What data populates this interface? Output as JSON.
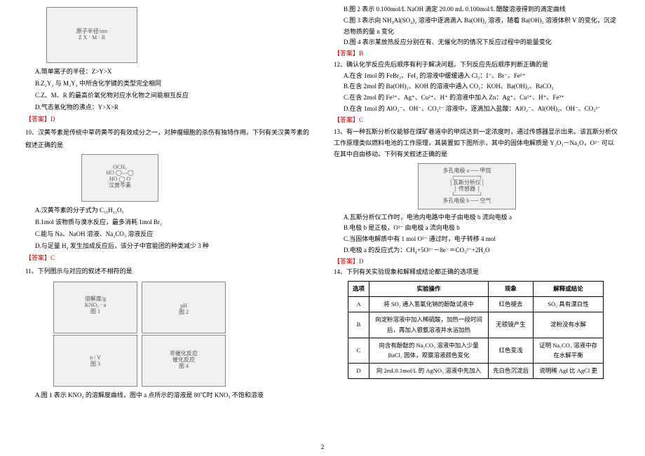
{
  "pageNumber": "2",
  "left": {
    "opt9A": "A.简单离子的半径：Z>Y>X",
    "opt9B": "B.Z₂Y₂ 与 M₂Y₂ 中所含化学键的类型完全相同",
    "opt9C": "C.Z、M、R 的最高价氧化物对应水化物之间能相互反应",
    "opt9D": "D.气态氢化物的沸点：Y>X>R",
    "ans9": "【答案】D",
    "q10": "10、汉黄芩素是传统中草药黄芩的有效成分之一，对肿瘤细胞的杀伤有独特作用。下列有关汉黄芩素的叙述正确的是",
    "fig10Caption": "汉黄芩素",
    "opt10A": "A.汉黄芩素的分子式为 C₁₆H₁₂O₅",
    "opt10B": "B.1mol 该物质与溴水反应，最多消耗 1mol Br₂",
    "opt10C": "C.能与 Na、NaOH 溶液、Na₂CO₃ 溶液反应",
    "opt10D": "D.与足量 H₂ 发生加成反应后，该分子中官能团的种类减少 3 种",
    "ans10": "【答案】C",
    "q11": "11、下列图示与对应的叙述不相符的是",
    "opt11A": "A.图 1 表示 KNO₃ 的溶解度曲线，图中 a 点所示的溶液是 80℃时 KNO₃ 不饱和溶液"
  },
  "right": {
    "opt11B": "B.图 2 表示 0.100mol/L NaOH 滴定 20.00 mL 0.100mol/L 醋酸溶液得到的滴定曲线",
    "opt11C": "C.图 3 表示向 NH₄Al(SO₄)₂ 溶液中逐滴滴入 Ba(OH)₂ 溶液，随着 Ba(OH)₂ 溶液体积 V 的变化，沉淀总物质的量 n 变化",
    "opt11D": "D.图 4 表示某放热反应分别在有、无催化剂的情况下反应过程中的能量变化",
    "ans11": "【答案】B",
    "q12": "12、确认化学反应先后顺序有利于解决问题。下列反应先后顺序判断正确的是",
    "opt12A": "A.在含 1mol 的 FeBr₂、FeI₂ 的溶液中缓缓通入 Cl₂：I⁻、Br⁻、Fe²⁺",
    "opt12B": "B.在含 2mol 的 Ba(OH)₂、KOH 的溶液中通入 CO₂：KOH、Ba(OH)₂、BaCO₃",
    "opt12C": "C.在含 2mol 的 Fe³⁺、Ag⁺、Cu²⁺、H⁺ 的溶液中加入 Zn：Ag⁺、Cu²⁺、H⁺、Fe³⁺",
    "opt12D": "D.在含 1mol 的 AlO₂⁻、OH⁻、CO₃²⁻ 溶液中，逐滴加入盐酸：AlO₂⁻、Al(OH)₃、OH⁻、CO₃²⁻",
    "ans12": "【答案】C",
    "q13": "13、有一种瓦斯分析仪能够在煤矿巷道中的甲烷达到一定浓度时，通过传感器显示出来。该瓦斯分析仪工作原理类似燃料电池的工作原理，其装置如下图所示，其中的固体电解质是 Y₂O₃－Na₂O，O²⁻ 可以在其中自由移动。下列有关叙述正确的是",
    "opt13A": "A.瓦斯分析仪工作时，电池内电路中电子由电极 b 流向电极 a",
    "opt13B": "B.电极 b 是正极，O²⁻ 由电极 a 流向电极 b",
    "opt13C": "C.当固体电解质中有 1 mol O²⁻ 通过时，电子转移 4 mol",
    "opt13D": "D.电极 a 的反应式为：CH₄+5O²⁻－8e⁻＝CO₃²⁻+2H₂O",
    "ans13": "【答案】D",
    "q14": "14、下列有关实验现象和解释或结论都正确的选项是",
    "table": {
      "h1": "选项",
      "h2": "实验操作",
      "h3": "现象",
      "h4": "解释或结论",
      "rA1": "A",
      "rA2": "将 SO₂ 通入氢氧化钠的酚酞试液中",
      "rA3": "红色褪去",
      "rA4": "SO₂ 具有漂白性",
      "rB1": "B",
      "rB2": "向淀粉溶液中加入稀硫酸，加热一段时间后，再加入银氨溶液并水浴加热",
      "rB3": "无银镜产生",
      "rB4": "淀粉没有水解",
      "rC1": "C",
      "rC2": "向含有酚酞的 Na₂CO₃ 溶液中加入少量 BaCl₂ 固体，观察溶液颜色变化",
      "rC3": "红色变浅",
      "rC4": "证明 Na₂CO₃ 溶液中存在水解平衡",
      "rD1": "D",
      "rD2": "向 2mL0.1mol/L 的 AgNO₃ 溶液中先加入",
      "rD3": "先白色沉淀后",
      "rD4": "说明稀 AgI 比 AgCl 更"
    }
  }
}
